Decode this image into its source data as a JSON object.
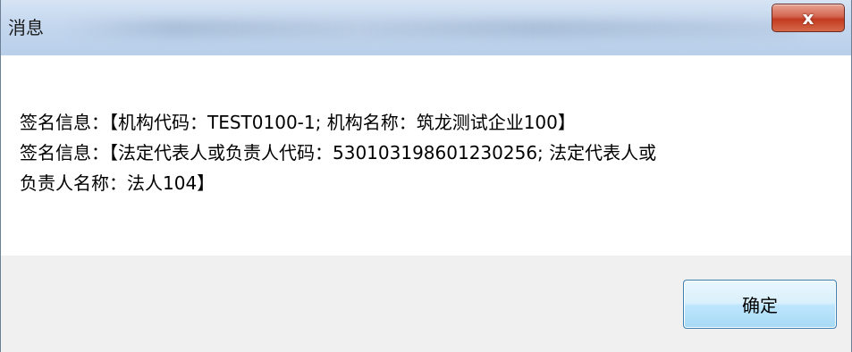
{
  "window": {
    "title": "消息",
    "close_icon": "close-icon",
    "close_glyph": "x"
  },
  "message": {
    "lines": [
      "签名信息：【机构代码：TEST0100-1; 机构名称：筑龙测试企业100】",
      "签名信息：【法定代表人或负责人代码：530103198601230256; 法定代表人或",
      "负责人名称：法人104】"
    ]
  },
  "footer": {
    "ok_label": "确定"
  },
  "colors": {
    "close_button": "#c33a20",
    "ok_border": "#3c7fb1",
    "footer_bg": "#f0f0f0"
  }
}
